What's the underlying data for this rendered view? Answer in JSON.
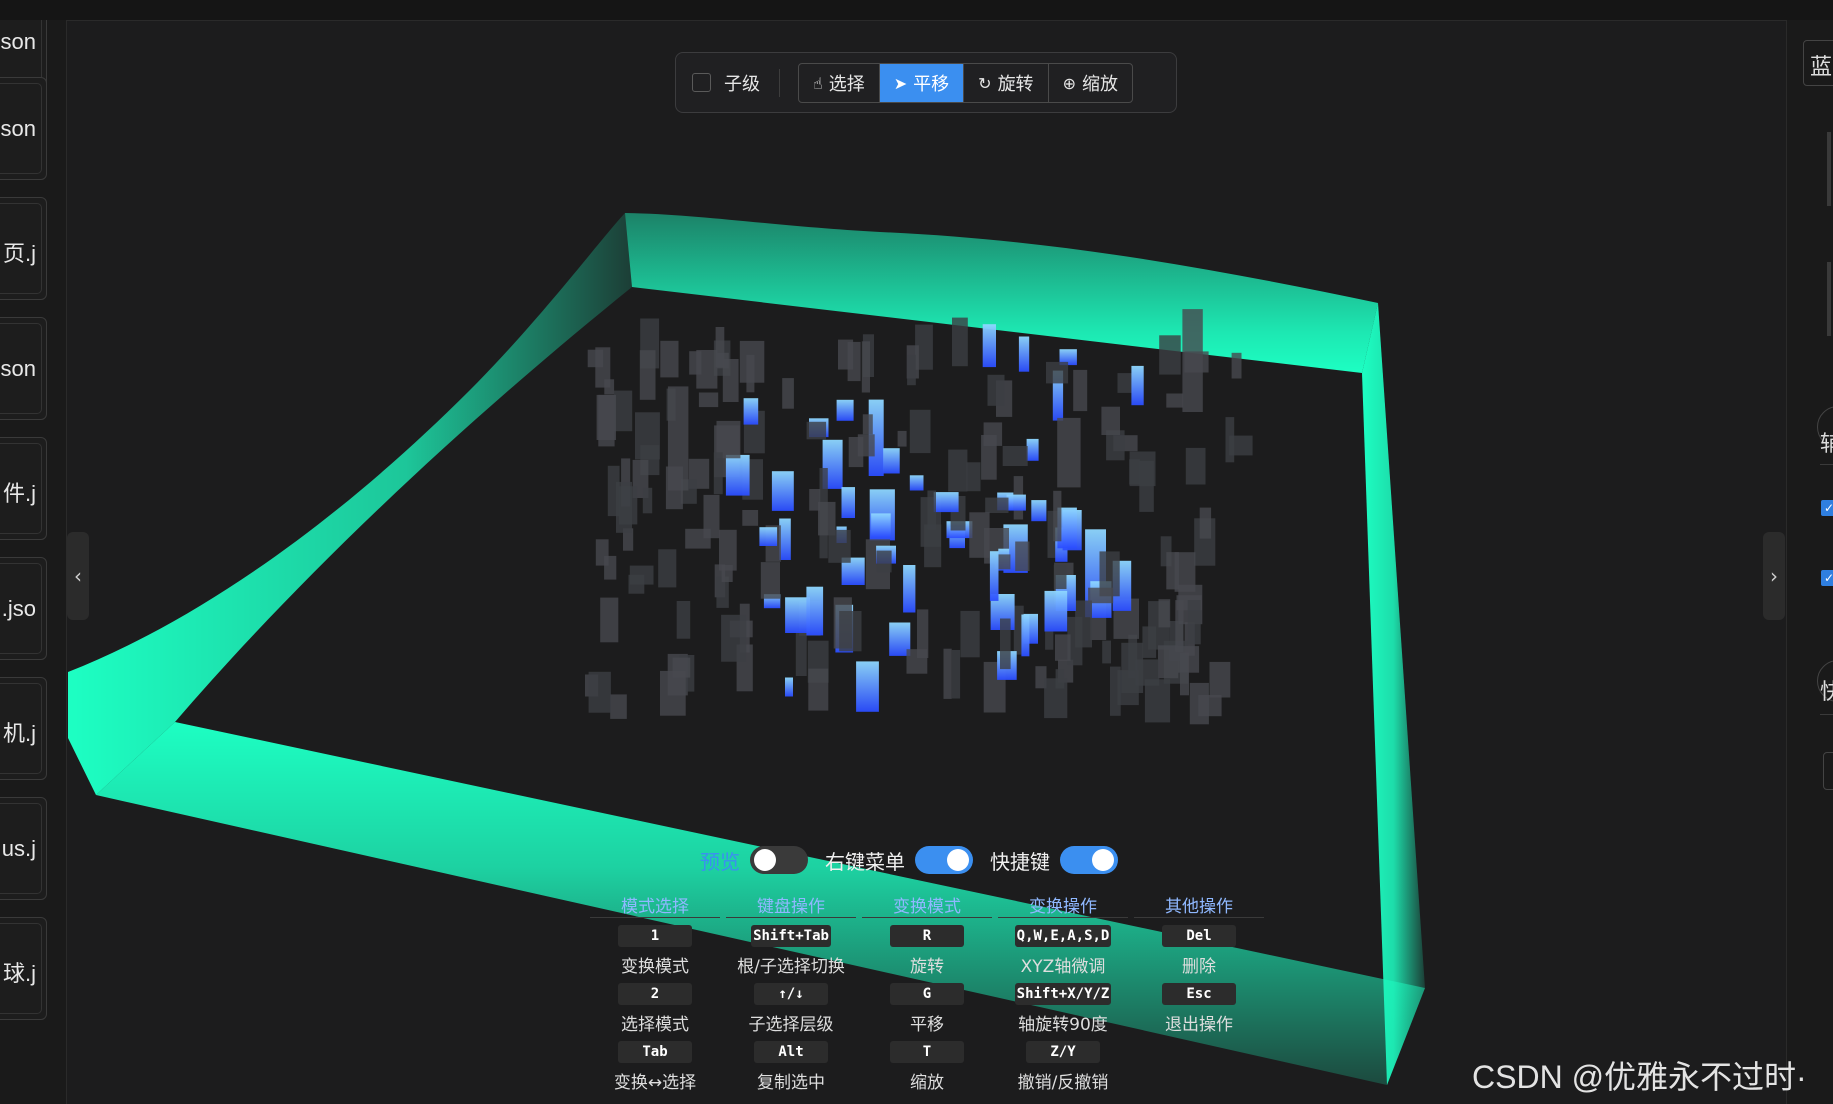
{
  "files": [
    ".json",
    ".json",
    "页.j",
    ".json",
    "件.j",
    ".jso",
    "机.j",
    "us.j",
    "球.j"
  ],
  "right_panel": {
    "top_label": "蓝",
    "section1": "辅",
    "section2": "快"
  },
  "toolbar": {
    "child_label": "子级",
    "buttons": [
      {
        "label": "选择",
        "icon": "hand-pointer-icon"
      },
      {
        "label": "平移",
        "icon": "send-arrow-icon",
        "active": true
      },
      {
        "label": "旋转",
        "icon": "rotate-icon"
      },
      {
        "label": "缩放",
        "icon": "zoom-in-icon"
      }
    ]
  },
  "toggles": {
    "preview": {
      "label": "预览",
      "on": false
    },
    "context_menu": {
      "label": "右键菜单",
      "on": true
    },
    "hotkeys": {
      "label": "快捷键",
      "on": true
    }
  },
  "shortcuts": {
    "columns": [
      {
        "title": "模式选择",
        "rows": [
          {
            "key": "1",
            "desc": "变换模式"
          },
          {
            "key": "2",
            "desc": "选择模式"
          },
          {
            "key": "Tab",
            "desc": "变换↔选择"
          }
        ]
      },
      {
        "title": "键盘操作",
        "rows": [
          {
            "key": "Shift+Tab",
            "desc": "根/子选择切换"
          },
          {
            "key": "↑/↓",
            "desc": "子选择层级"
          },
          {
            "key": "Alt",
            "desc": "复制选中"
          }
        ]
      },
      {
        "title": "变换模式",
        "rows": [
          {
            "key": "R",
            "desc": "旋转"
          },
          {
            "key": "G",
            "desc": "平移"
          },
          {
            "key": "T",
            "desc": "缩放"
          }
        ]
      },
      {
        "title": "变换操作",
        "rows": [
          {
            "key": "Q,W,E,A,S,D",
            "desc": "XYZ轴微调"
          },
          {
            "key": "Shift+X/Y/Z",
            "desc": "轴旋转90度"
          },
          {
            "key": "Z/Y",
            "desc": "撤销/反撤销"
          }
        ]
      },
      {
        "title": "其他操作",
        "rows": [
          {
            "key": "Del",
            "desc": "删除"
          },
          {
            "key": "Esc",
            "desc": "退出操作"
          }
        ]
      }
    ]
  },
  "colors": {
    "accent": "#3b8ff0",
    "wall": "#1dffc3",
    "building": "#3f4146",
    "highlight": "#3f7fff"
  },
  "watermark": "CSDN @优雅永不过时·"
}
